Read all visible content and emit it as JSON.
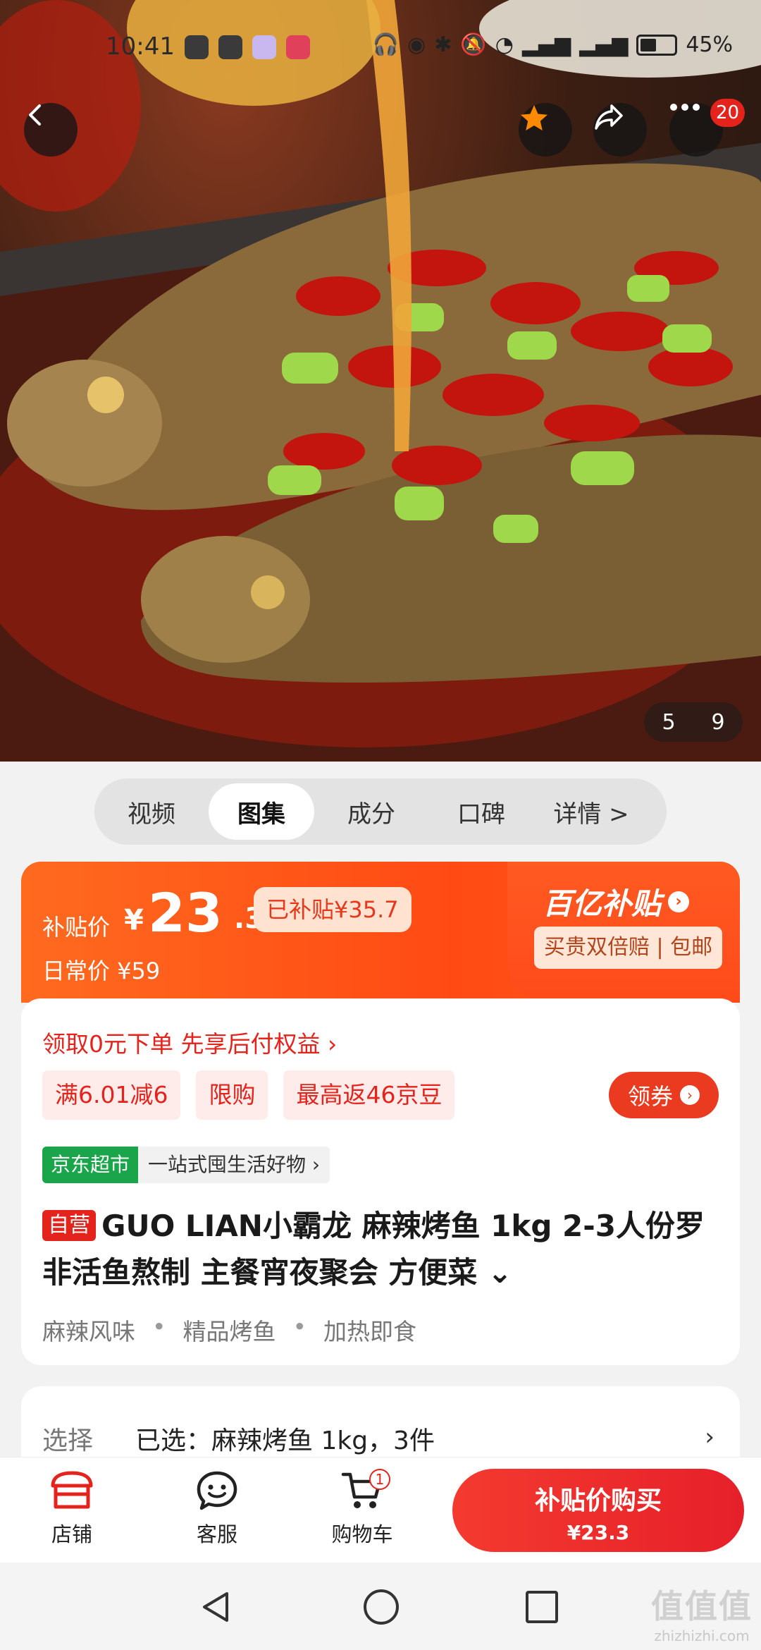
{
  "status_bar": {
    "time": "10:41",
    "battery": "45%"
  },
  "hero": {
    "image_counter": {
      "current": "5",
      "total": "9"
    },
    "more_badge": "20"
  },
  "media_tabs": [
    {
      "label": "视频"
    },
    {
      "label": "图集"
    },
    {
      "label": "成分"
    },
    {
      "label": "口碑"
    },
    {
      "label": "详情 >"
    }
  ],
  "price": {
    "label": "补贴价",
    "currency": "¥",
    "integer": "23",
    "decimal": ".3",
    "subsidized": "已补贴¥35.7",
    "daily": "日常价 ¥59",
    "subsidy_program": "百亿补贴",
    "subsidy_tags": "买贵双倍赔 | 包邮"
  },
  "promo": {
    "pay_later": "领取0元下单 先享后付权益 ›",
    "tags": [
      "满6.01减6",
      "限购",
      "最高返46京豆"
    ],
    "coupon_button": "领券"
  },
  "store": {
    "name": "京东超市",
    "slogan": "一站式囤生活好物 ›"
  },
  "product": {
    "self_tag": "自营",
    "title": "GUO LIAN小霸龙 麻辣烤鱼 1kg 2-3人份罗非活鱼熬制 主餐宵夜聚会 方便菜 ⌄",
    "features": [
      "麻辣风味",
      "精品烤鱼",
      "加热即食"
    ],
    "feature_separator": "•"
  },
  "selection": {
    "label": "选择",
    "value": "已选：麻辣烤鱼 1kg，3件",
    "chevron": "›"
  },
  "action_bar": {
    "shop": "店铺",
    "service": "客服",
    "cart": "购物车",
    "cart_badge": "1",
    "buy_title": "补贴价购买",
    "buy_price": "¥23.3"
  },
  "watermark": {
    "main": "值值值",
    "sub": "zhizhizhi.com"
  },
  "colors": {
    "brand_red": "#e4231d",
    "subsidy_orange": "#ff4a14",
    "supermarket_green": "#1aa54a"
  }
}
